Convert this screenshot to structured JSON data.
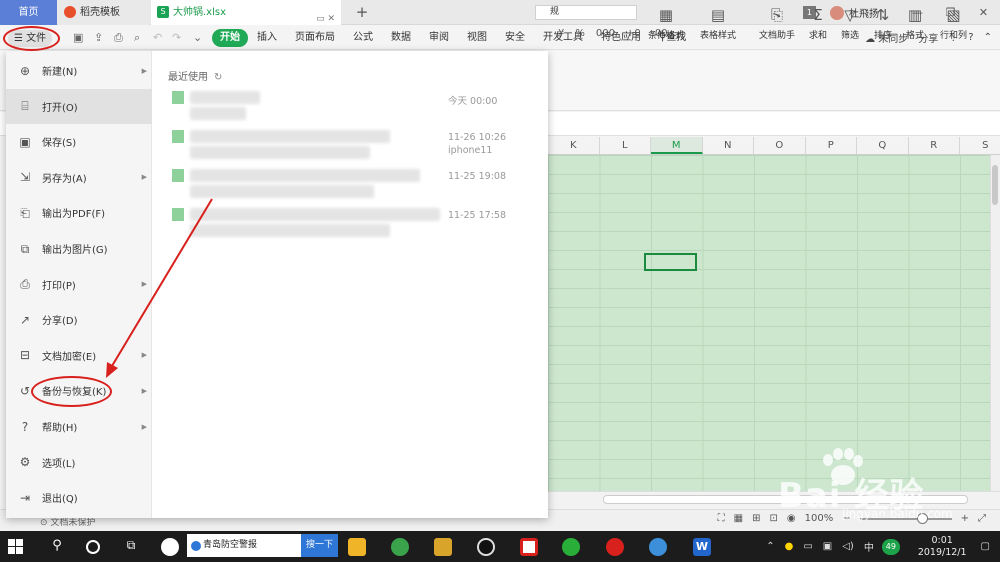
{
  "tabs": {
    "home": "首页",
    "docer": "稻壳模板",
    "file": "大帅锅.xlsx"
  },
  "topbar": {
    "count": "1",
    "username": "杜飛扬"
  },
  "menu": {
    "file_label": "文件",
    "tabs": [
      "开始",
      "插入",
      "页面布局",
      "公式",
      "数据",
      "审阅",
      "视图",
      "安全",
      "开发工具",
      "特色应用"
    ],
    "search": "查找",
    "sync": "未同步",
    "share": "分享"
  },
  "ribbon": {
    "format_value": "规",
    "format_symbols": [
      "%",
      "000",
      "+0",
      ".00"
    ],
    "buttons": [
      "条件格式",
      "表格样式",
      "文档助手",
      "求和",
      "筛选",
      "排序",
      "格式",
      "行和列"
    ]
  },
  "sheet": {
    "columns": [
      "K",
      "L",
      "M",
      "N",
      "O",
      "P",
      "Q",
      "R",
      "S"
    ],
    "selected_column": "M"
  },
  "filemenu": {
    "items": [
      {
        "label": "新建(N)",
        "icon": "new-file-icon",
        "arrow": true
      },
      {
        "label": "打开(O)",
        "icon": "folder-open-icon",
        "arrow": false
      },
      {
        "label": "保存(S)",
        "icon": "save-icon",
        "arrow": false
      },
      {
        "label": "另存为(A)",
        "icon": "save-as-icon",
        "arrow": true
      },
      {
        "label": "输出为PDF(F)",
        "icon": "pdf-icon",
        "arrow": false
      },
      {
        "label": "输出为图片(G)",
        "icon": "image-export-icon",
        "arrow": false
      },
      {
        "label": "打印(P)",
        "icon": "print-icon",
        "arrow": true
      },
      {
        "label": "分享(D)",
        "icon": "share-icon",
        "arrow": false
      },
      {
        "label": "文档加密(E)",
        "icon": "encrypt-icon",
        "arrow": true
      },
      {
        "label": "备份与恢复(K)",
        "icon": "backup-icon",
        "arrow": true
      },
      {
        "label": "帮助(H)",
        "icon": "help-icon",
        "arrow": true
      },
      {
        "label": "选项(L)",
        "icon": "options-gear-icon",
        "arrow": false
      },
      {
        "label": "退出(Q)",
        "icon": "exit-icon",
        "arrow": false
      }
    ],
    "recent_title": "最近使用",
    "recent_files": [
      {
        "time": "今天 00:00",
        "sub": ""
      },
      {
        "time": "11-26 10:26",
        "sub": "iphone11"
      },
      {
        "time": "11-25 19:08",
        "sub": ""
      },
      {
        "time": "11-25 17:58",
        "sub": ""
      }
    ]
  },
  "status": {
    "left": "文档未保护",
    "zoom": "100%"
  },
  "taskbar": {
    "search_text": "青岛防空警报",
    "search_button": "搜一下",
    "ime": "中",
    "badge": "49",
    "time": "0:01",
    "date": "2019/12/1"
  },
  "watermark": {
    "text": "Bai 经验",
    "url": "jingyan.baidu.com"
  },
  "colors": {
    "accent": "#20a956",
    "home_tab": "#5b7fd6",
    "grid_fill": "#cde7cf",
    "annotation": "#d8201c"
  }
}
